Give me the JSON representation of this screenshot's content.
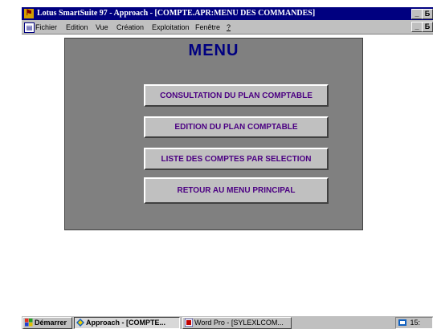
{
  "window": {
    "title": "Lotus SmartSuite 97   - Approach - [COMPTE.APR:MENU DES COMMANDES]",
    "minimize_glyph": "_",
    "maximize_glyph": "Б",
    "app_icon_glyph": "⚑"
  },
  "menubar": {
    "items": [
      {
        "label": "Fichier"
      },
      {
        "label": "Edition"
      },
      {
        "label": "Vue"
      },
      {
        "label": "Création"
      },
      {
        "label": "Exploitation"
      },
      {
        "label": "Fenêtre"
      },
      {
        "label": "?"
      }
    ]
  },
  "panel": {
    "title": "MENU",
    "buttons": [
      {
        "label": "CONSULTATION DU  PLAN COMPTABLE"
      },
      {
        "label": "EDITION DU PLAN COMPTABLE"
      },
      {
        "label": "LISTE DES COMPTES PAR SELECTION"
      },
      {
        "label": "RETOUR AU MENU PRINCIPAL"
      }
    ],
    "colors": {
      "background": "#808080",
      "title": "#000080",
      "button_text": "#4b0082"
    }
  },
  "taskbar": {
    "start_label": "Démarrer",
    "tasks": [
      {
        "label": "Approach - [COMPTE..."
      },
      {
        "label": "Word Pro - [SYLEXLCOM..."
      }
    ],
    "clock": "15:"
  }
}
